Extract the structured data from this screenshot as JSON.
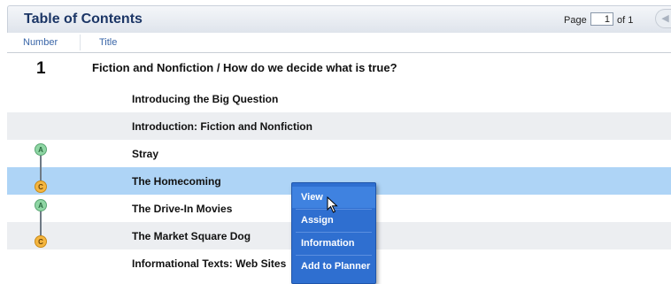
{
  "toc": {
    "title": "Table of Contents",
    "page_label": "Page",
    "page_value": "1",
    "page_of": "of 1"
  },
  "columns": {
    "number": "Number",
    "title": "Title"
  },
  "chapter": {
    "number": "1",
    "title": "Fiction and Nonfiction / How do we decide what is true?"
  },
  "rows": [
    {
      "title": "Introducing the Big Question"
    },
    {
      "title": "Introduction: Fiction and Nonfiction"
    },
    {
      "title": "Stray",
      "badge": "A"
    },
    {
      "title": "The Homecoming",
      "badge": "C"
    },
    {
      "title": "The Drive-In Movies",
      "badge": "A"
    },
    {
      "title": "The Market Square Dog",
      "badge": "C"
    },
    {
      "title": "Informational Texts: Web Sites"
    }
  ],
  "context_menu": {
    "items": [
      "View",
      "Assign",
      "Information",
      "Add to Planner"
    ]
  },
  "colors": {
    "selected_row": "#aed4f6",
    "menu_bg": "#2f6fd0",
    "badge_a": "#8fd6a4",
    "badge_c": "#f5b640"
  }
}
